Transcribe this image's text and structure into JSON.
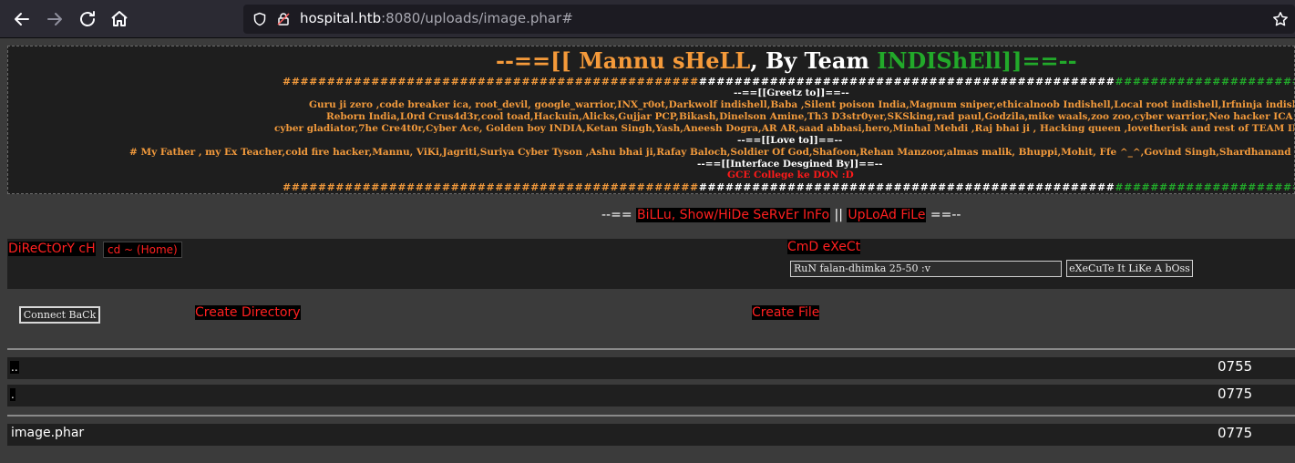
{
  "browser": {
    "url_host": "hospital.htb",
    "url_rest": ":8080/uploads/image.phar#"
  },
  "banner": {
    "title_left": "--==[[ Mannu sHeLL",
    "title_mid": ", By Team ",
    "title_right": "INDIShEll]]==--",
    "hash_orange": "###############################################",
    "hash_white": "###############################################",
    "hash_green": "###############################################",
    "greetz_heading": "--==[[Greetz to]]==--",
    "greetz_line1": "Guru ji zero ,code breaker ica, root_devil, google_warrior,INX_r0ot,Darkwolf indishell,Baba ,Silent poison India,Magnum sniper,ethicalnoob Indishell,Local root indishell,Irfninja indishell",
    "greetz_line2": "Reborn India,L0rd Crus4d3r,cool toad,Hackuin,Alicks,Gujjar PCP,Bikash,Dinelson Amine,Th3 D3str0yer,SKSking,rad paul,Godzila,mike waals,zoo zoo,cyber warrior,Neo hacker ICA",
    "greetz_line3": "cyber gladiator,7he Cre4t0r,Cyber Ace, Golden boy INDIA,Ketan Singh,Yash,Aneesh Dogra,AR AR,saad abbasi,hero,Minhal Mehdi ,Raj bhai ji , Hacking queen ,lovetherisk and rest of TEAM INDISHELL",
    "love_heading": "--==[[Love to]]==--",
    "love_line": "# My Father , my Ex Teacher,cold fire hacker,Mannu, ViKi,Jagriti,Suriya Cyber Tyson ,Ashu bhai ji,Rafay Baloch,Soldier Of God,Shafoon,Rehan Manzoor,almas malik, Bhuppi,Mohit, Ffe ^_^,Govind Singh,Shardhanand ,Budhaoo,Don(Deepika kaushik) and D",
    "interface_heading": "--==[[Interface Desgined By]]==--",
    "interface_credit": "GCE College ke DON :D"
  },
  "menu": {
    "prefix": "--== ",
    "link1": "BiLLu, Show/HiDe SeRvEr InFo",
    "separator": " || ",
    "link2": "UpLoAd FiLe",
    "suffix": " ==--"
  },
  "panel": {
    "dir_label": "DiReCtOrY cH",
    "dir_select": "cd ~ (Home)",
    "cmd_label": "CmD eXeCt",
    "cmd_input": "RuN falan-dhimka 25-50 :v",
    "exec_button": "eXeCuTe It LiKe A bOss"
  },
  "actions": {
    "connect_back": "Connect BaCk",
    "create_directory": "Create Directory",
    "create_file": "Create File"
  },
  "files": {
    "dirs": [
      {
        "name": "..",
        "perm": "0755"
      },
      {
        "name": ".",
        "perm": "0775"
      }
    ],
    "items": [
      {
        "name": "image.phar",
        "perm": "0775"
      }
    ]
  }
}
